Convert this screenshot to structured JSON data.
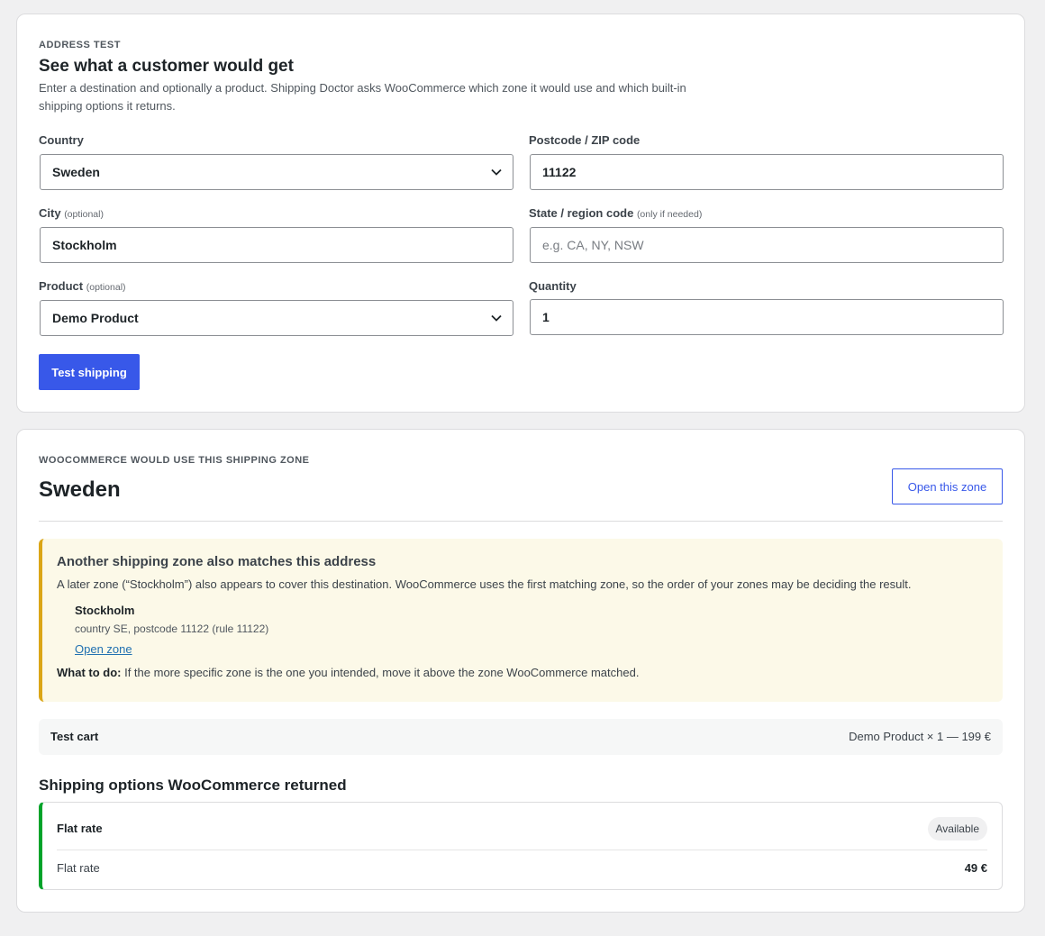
{
  "address_test": {
    "eyebrow": "ADDRESS TEST",
    "title": "See what a customer would get",
    "description": "Enter a destination and optionally a product. Shipping Doctor asks WooCommerce which zone it would use and which built-in shipping options it returns.",
    "country": {
      "label": "Country",
      "value": "Sweden"
    },
    "postcode": {
      "label": "Postcode / ZIP code",
      "value": "11122"
    },
    "city": {
      "label": "City",
      "hint": "(optional)",
      "value": "Stockholm"
    },
    "state": {
      "label": "State / region code",
      "hint": "(only if needed)",
      "placeholder": "e.g. CA, NY, NSW"
    },
    "product": {
      "label": "Product",
      "hint": "(optional)",
      "value": "Demo Product"
    },
    "quantity": {
      "label": "Quantity",
      "value": "1"
    },
    "submit_label": "Test shipping"
  },
  "result": {
    "eyebrow": "WOOCOMMERCE WOULD USE THIS SHIPPING ZONE",
    "zone_name": "Sweden",
    "open_zone_button": "Open this zone",
    "notice": {
      "title": "Another shipping zone also matches this address",
      "text": "A later zone (“Stockholm”) also appears to cover this destination. WooCommerce uses the first matching zone, so the order of your zones may be deciding the result.",
      "match_name": "Stockholm",
      "match_rule": "country SE, postcode 11122 (rule 11122)",
      "match_link": "Open zone",
      "todo_label": "What to do:",
      "todo_text": " If the more specific zone is the one you intended, move it above the zone WooCommerce matched."
    },
    "cart": {
      "label": "Test cart",
      "value": "Demo Product × 1 — 199 €"
    },
    "options_title": "Shipping options WooCommerce returned",
    "option": {
      "name": "Flat rate",
      "status": "Available",
      "line_label": "Flat rate",
      "price": "49 €"
    }
  },
  "colors": {
    "primary": "#3858e9",
    "warning": "#dba617",
    "success": "#00a32a"
  }
}
